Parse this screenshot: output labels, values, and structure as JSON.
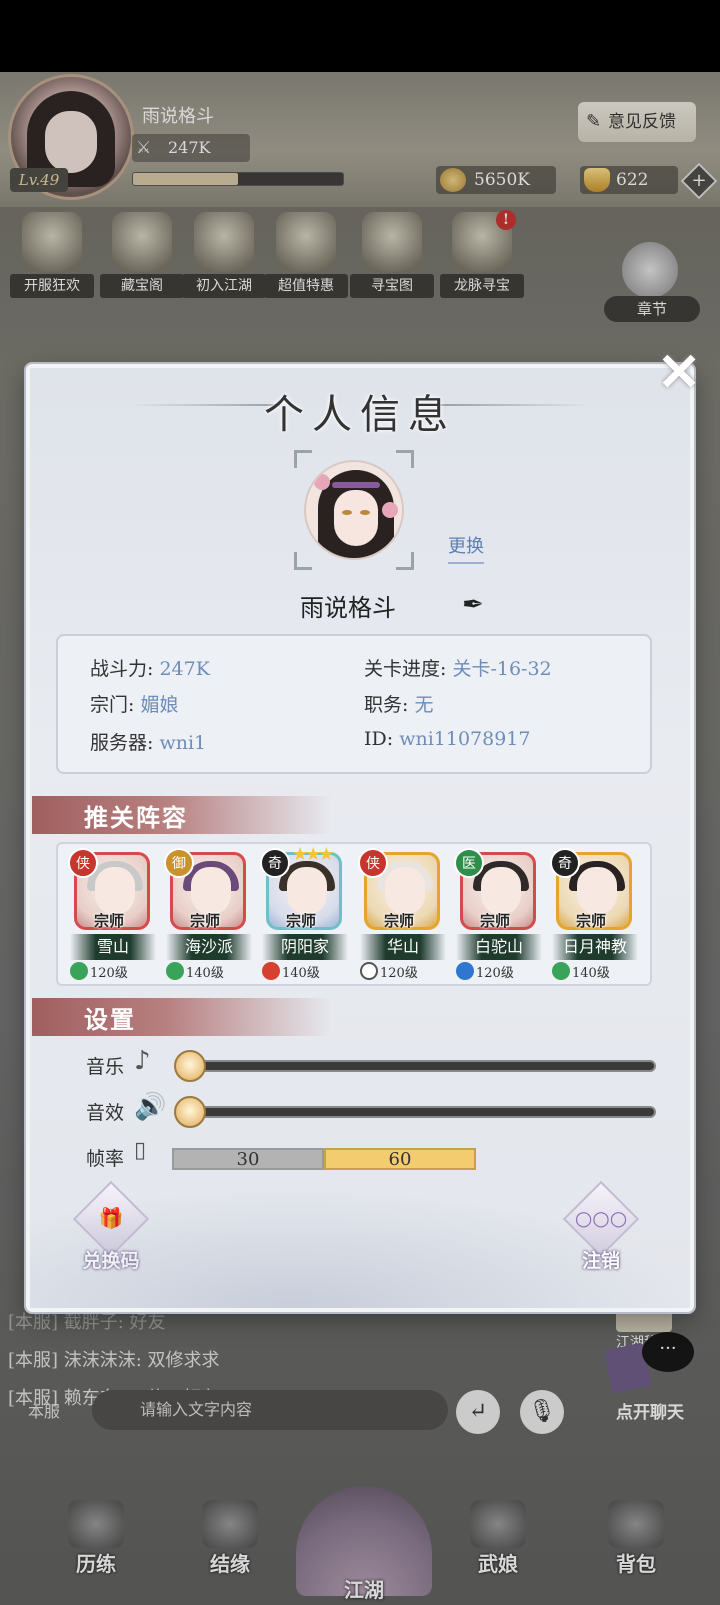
{
  "hud": {
    "player_name": "雨说格斗",
    "level": "Lv.49",
    "power": "247K",
    "exp_fraction": 0.5,
    "feedback_label": "意见反馈",
    "gold": "5650K",
    "ingot": "622",
    "plus_symbol": "+"
  },
  "events": [
    {
      "label": "开服狂欢",
      "icon": "scroll-icon"
    },
    {
      "label": "藏宝阁",
      "icon": "pavilion-icon"
    },
    {
      "label": "初入江湖",
      "icon": "taiji-icon"
    },
    {
      "label": "超值特惠",
      "icon": "treasure-icon"
    },
    {
      "label": "寻宝图",
      "icon": "map-icon"
    },
    {
      "label": "龙脉寻宝",
      "icon": "compass-icon",
      "badge": "!"
    }
  ],
  "chapter_label": "章节",
  "chat": {
    "lines": [
      {
        "text": "[本服] 截胖子: 好友"
      },
      {
        "text": "[本服] 沫沫沫沫: 双修求求"
      },
      {
        "text": "[本服] 赖东东: 双修，好友"
      }
    ],
    "channel": "本服",
    "placeholder": "请输入文字内容",
    "open_chat": "点开聊天",
    "secret_label": "江湖秘籍",
    "bubble": "···"
  },
  "nav": [
    {
      "label": "历练"
    },
    {
      "label": "结缘"
    },
    {
      "label": "江湖"
    },
    {
      "label": "武娘"
    },
    {
      "label": "背包"
    }
  ],
  "modal": {
    "title": "个人信息",
    "change_label": "更换",
    "nickname": "雨说格斗",
    "close": "✕",
    "info": {
      "power_label": "战斗力:",
      "power_value": "247K",
      "stage_label": "关卡进度:",
      "stage_value": "关卡-16-32",
      "sect_label": "宗门:",
      "sect_value": "媚娘",
      "role_label": "职务:",
      "role_value": "无",
      "server_label": "服务器:",
      "server_value": "wni1",
      "id_label": "ID:",
      "id_value": "wni11078917"
    },
    "team_header": "推关阵容",
    "team": [
      {
        "seal": "侠",
        "tag": "宗师",
        "name": "雪山",
        "level": "120级"
      },
      {
        "seal": "御",
        "tag": "宗师",
        "name": "海沙派",
        "level": "140级"
      },
      {
        "seal": "奇",
        "tag": "宗师",
        "name": "阴阳家",
        "level": "140级",
        "stars": "★★★"
      },
      {
        "seal": "侠",
        "tag": "宗师",
        "name": "华山",
        "level": "120级"
      },
      {
        "seal": "医",
        "tag": "宗师",
        "name": "白驼山",
        "level": "120级"
      },
      {
        "seal": "奇",
        "tag": "宗师",
        "name": "日月神教",
        "level": "140级"
      }
    ],
    "settings_header": "设置",
    "music_label": "音乐",
    "music_level": 0,
    "sfx_label": "音效",
    "sfx_level": 0,
    "fps_label": "帧率",
    "fps_options": [
      "30",
      "60"
    ],
    "fps_selected": "60",
    "redeem_label": "兑换码",
    "logout_label": "注销"
  },
  "colors": {
    "link": "#5d7fb4",
    "value": "#6e8db9",
    "section_header": "#a05f5f",
    "fps_selected": "#f3cc70"
  }
}
